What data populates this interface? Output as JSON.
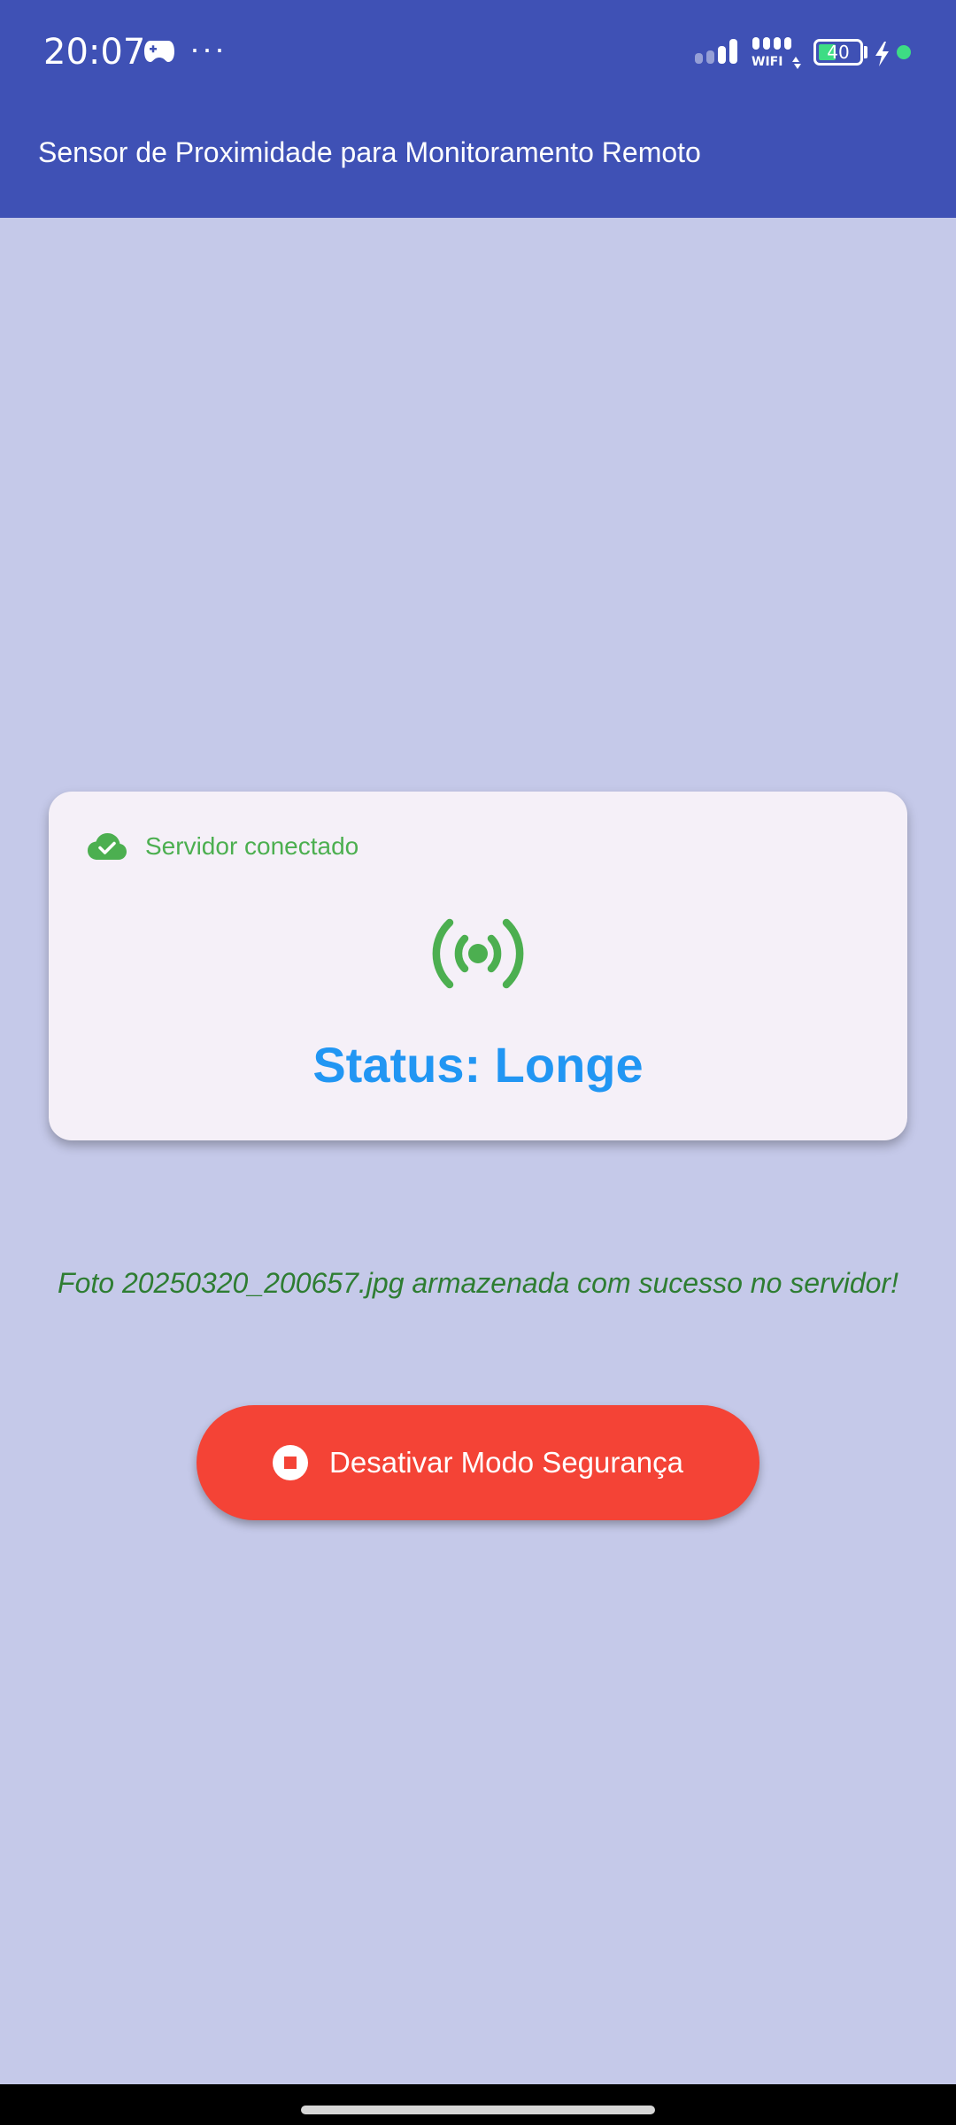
{
  "status_bar": {
    "time": "20:07",
    "more": "···",
    "battery_level": "40",
    "icons": [
      "gamepad-icon",
      "signal-icon",
      "wifi-icon",
      "battery-icon",
      "charging-icon",
      "dot-indicator"
    ],
    "colors": {
      "indicator": "#3ddc84"
    }
  },
  "app_bar": {
    "title": "Sensor de Proximidade para Monitoramento Remoto",
    "color": "#3f51b5"
  },
  "card": {
    "server_status": "Servidor conectado",
    "server_icon": "cloud-check-icon",
    "sensor_icon": "sensors-icon",
    "status": "Status: Longe"
  },
  "message": "Foto 20250320_200657.jpg armazenada com sucesso no servidor!",
  "action_button": {
    "label": "Desativar Modo Segurança",
    "icon": "stop-circle-icon",
    "color": "#f44336"
  },
  "colors": {
    "background": "#c5c9e9",
    "card": "#f5f0f8",
    "success": "#4caf50",
    "status": "#2196f3",
    "message": "#2e7d32"
  }
}
